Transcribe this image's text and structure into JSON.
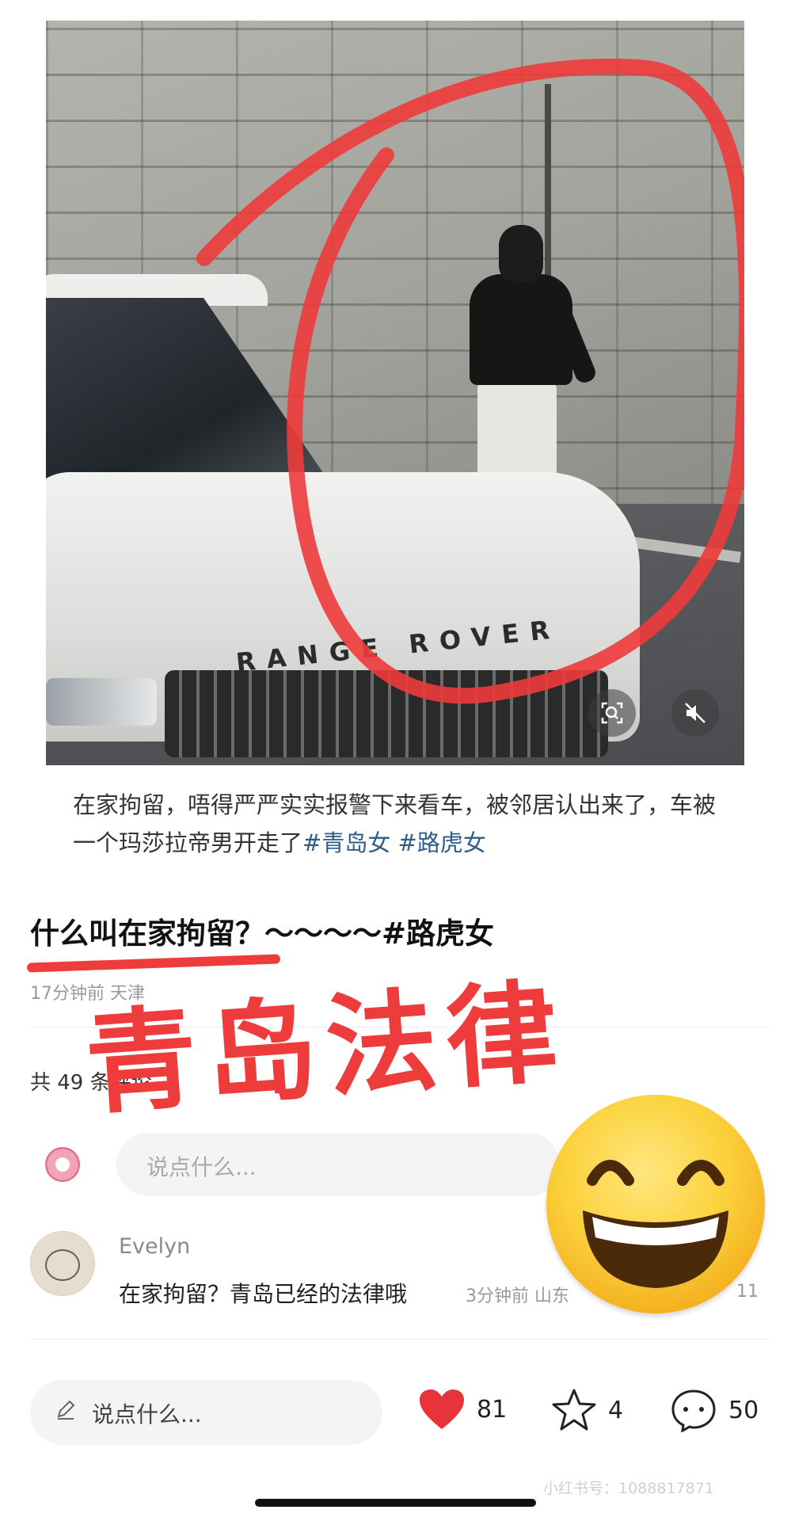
{
  "post": {
    "caption": "在家拘留，唔得严严实实报警下来看车，被邻居认出来了，车被一个玛莎拉帝男开走了",
    "hashtags": [
      "#青岛女",
      "#路虎女"
    ],
    "video_badge_text": "RANGE ROVER"
  },
  "comment": {
    "title": "什么叫在家拘留？～～～～#路虎女",
    "meta": "17分钟前 天津",
    "count_label": "共 49 条评论",
    "reply_placeholder": "说点什么...",
    "items": [
      {
        "author": "Evelyn",
        "text": "在家拘留？青岛已经的法律哦",
        "time": "3分钟前 山东",
        "likes": "11"
      }
    ]
  },
  "bottom_bar": {
    "input_placeholder": "说点什么...",
    "likes": "81",
    "stars": "4",
    "comments": "50"
  },
  "overlay": {
    "big_text": "青岛法律",
    "emoji": "grinning-face"
  },
  "watermark": "小红书号：1088817871",
  "colors": {
    "accent_red": "#ee3b3b",
    "hashtag_blue": "#2f5d8a",
    "like_heart": "#e8333a"
  }
}
